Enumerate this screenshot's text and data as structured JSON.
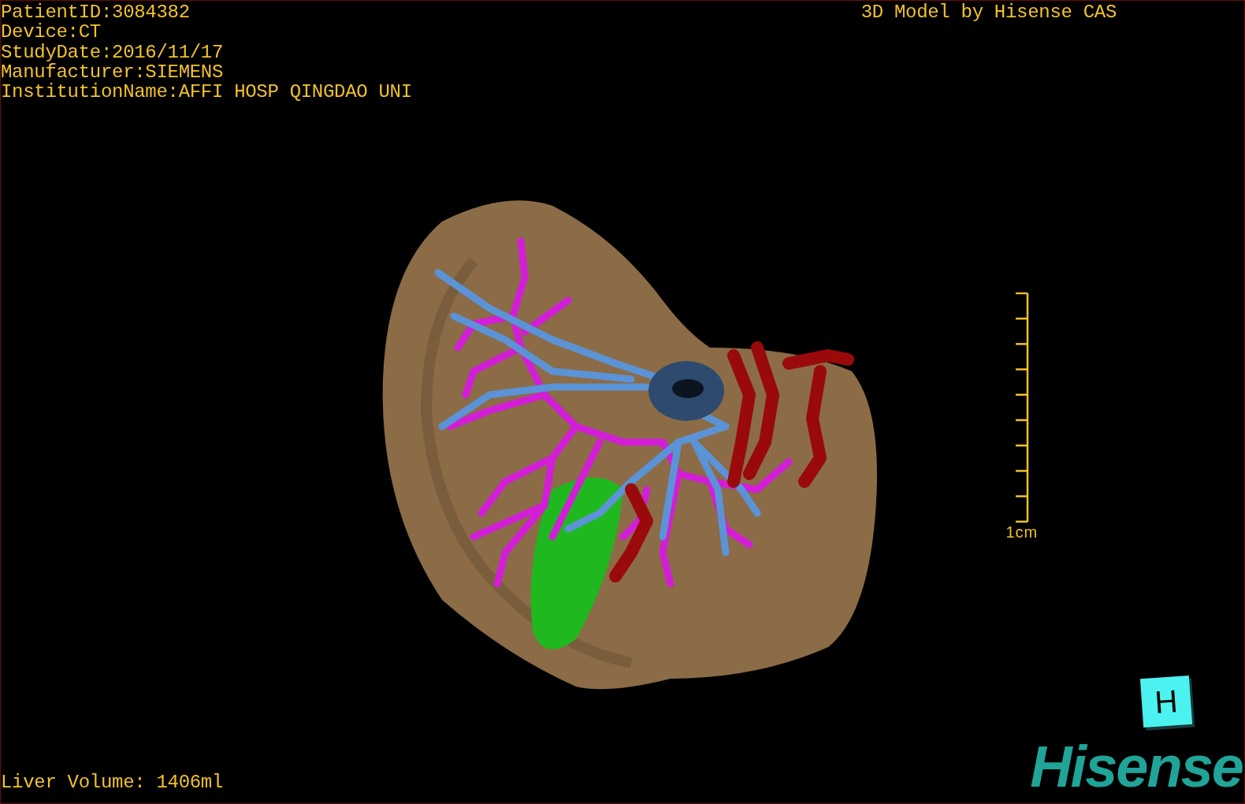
{
  "study_info": [
    "PatientID:3084382",
    "Device:CT",
    "StudyDate:2016/11/17",
    "Manufacturer:SIEMENS",
    "InstitutionName:AFFI HOSP QINGDAO UNI"
  ],
  "viewer_title": "3D Model by Hisense CAS",
  "scale_bar": {
    "label": "1cm"
  },
  "liver_volume": "Liver Volume: 1406ml",
  "orientation_marker": "H",
  "logo": "Hisense"
}
